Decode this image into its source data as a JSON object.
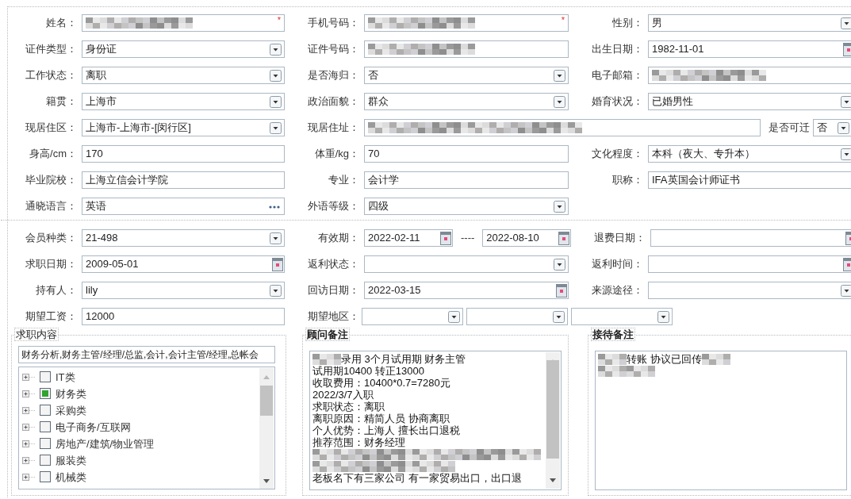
{
  "sections": [
    {
      "rows": [
        [
          {
            "label": "姓名：",
            "kind": "text",
            "redacted": true,
            "required_mark": "*"
          },
          {
            "label": "手机号码：",
            "kind": "text",
            "redacted": true,
            "required_mark": "*"
          },
          {
            "label": "性别：",
            "kind": "select",
            "value": "男"
          }
        ],
        [
          {
            "label": "证件类型：",
            "kind": "select",
            "value": "身份证"
          },
          {
            "label": "证件号码：",
            "kind": "text",
            "redacted": true
          },
          {
            "label": "出生日期：",
            "kind": "date",
            "value": "1982-11-01"
          }
        ],
        [
          {
            "label": "工作状态：",
            "kind": "select",
            "value": "离职"
          },
          {
            "label": "是否海归：",
            "kind": "select",
            "value": "否"
          },
          {
            "label": "电子邮箱：",
            "kind": "text",
            "redacted": true
          }
        ],
        [
          {
            "label": "籍贯：",
            "kind": "select",
            "value": "上海市"
          },
          {
            "label": "政治面貌：",
            "kind": "select",
            "value": "群众"
          },
          {
            "label": "婚育状况：",
            "kind": "select",
            "value": "已婚男性"
          }
        ],
        [
          {
            "label": "现居住区：",
            "kind": "select",
            "value": "上海市-上海市-[闵行区]"
          },
          {
            "label": "现居住址：",
            "kind": "wide-text",
            "redacted": true
          },
          {
            "label": "是否可迁",
            "kind": "short-select",
            "value": "否"
          }
        ],
        [
          {
            "label": "身高/cm：",
            "kind": "text",
            "value": "170"
          },
          {
            "label": "体重/kg：",
            "kind": "text",
            "value": "70"
          },
          {
            "label": "文化程度：",
            "kind": "select",
            "value": "本科（夜大、专升本）"
          }
        ],
        [
          {
            "label": "毕业院校：",
            "kind": "text",
            "value": "上海立信会计学院"
          },
          {
            "label": "专业：",
            "kind": "text",
            "value": "会计学"
          },
          {
            "label": "职称：",
            "kind": "text",
            "value": "IFA英国会计师证书"
          }
        ],
        [
          {
            "label": "通晓语言：",
            "kind": "picker",
            "value": "英语"
          },
          {
            "label": "外语等级：",
            "kind": "select",
            "value": "四级"
          }
        ]
      ]
    },
    {
      "rows": [
        [
          {
            "label": "会员种类：",
            "kind": "select",
            "value": "21-498"
          },
          {
            "label": "有效期：",
            "kind": "date-range",
            "value": "2022-02-11",
            "separator": "----",
            "value_end": "2022-08-10"
          },
          {
            "label": "退费日期：",
            "kind": "date"
          }
        ],
        [
          {
            "label": "求职日期：",
            "kind": "date",
            "value": "2009-05-01"
          },
          {
            "label": "返利状态：",
            "kind": "select"
          },
          {
            "label": "返利时间：",
            "kind": "date"
          }
        ],
        [
          {
            "label": "持有人：",
            "kind": "select",
            "value": "lily"
          },
          {
            "label": "回访日期：",
            "kind": "date",
            "value": "2022-03-15"
          },
          {
            "label": "来源途径：",
            "kind": "select"
          }
        ],
        [
          {
            "label": "期望工资：",
            "kind": "text",
            "value": "12000"
          },
          {
            "label": "期望地区：",
            "kind": "region-select"
          }
        ]
      ]
    }
  ],
  "job_content": {
    "title": "求职内容",
    "emphasized": false,
    "selected_text": "财务分析,财务主管/经理/总监,会计,会计主管/经理,总帐会",
    "tree": [
      {
        "label": "IT类",
        "checked": false,
        "expanded": false
      },
      {
        "label": "财务类",
        "checked": true,
        "expanded": false
      },
      {
        "label": "采购类",
        "checked": false,
        "expanded": false
      },
      {
        "label": "电子商务/互联网",
        "checked": false,
        "expanded": false
      },
      {
        "label": "房地产/建筑/物业管理",
        "checked": false,
        "expanded": false
      },
      {
        "label": "服装类",
        "checked": false,
        "expanded": false
      },
      {
        "label": "机械类",
        "checked": false,
        "expanded": false
      }
    ]
  },
  "notes": [
    {
      "title": "顾问备注",
      "emphasized": true,
      "scrollbar": true,
      "lines": [
        [
          {
            "kind": "blur-short"
          },
          {
            "kind": "text",
            "text": "录用 3个月试用期 财务主管"
          }
        ],
        [
          {
            "kind": "text",
            "text": "试用期10400 转正13000"
          }
        ],
        [
          {
            "kind": "text",
            "text": "收取费用：10400*0.7=7280元"
          }
        ],
        [
          {
            "kind": "text",
            "text": "2022/3/7入职"
          }
        ],
        [
          {
            "kind": "text",
            "text": "求职状态：离职"
          }
        ],
        [
          {
            "kind": "text",
            "text": "离职原因：精简人员  协商离职"
          }
        ],
        [
          {
            "kind": "text",
            "text": "个人优势：上海人 擅长出口退税"
          }
        ],
        [
          {
            "kind": "text",
            "text": "推荐范围：财务经理"
          }
        ],
        [
          {
            "kind": "blur-long"
          }
        ],
        [
          {
            "kind": "blur-half"
          }
        ],
        [
          {
            "kind": "text",
            "text": "老板名下有三家公司 有一家贸易出口，出口退"
          }
        ]
      ]
    },
    {
      "title": "接待备注",
      "emphasized": true,
      "scrollbar": false,
      "lines": [
        [
          {
            "kind": "blur-short"
          },
          {
            "kind": "text",
            "text": "转账 协议已回传 "
          },
          {
            "kind": "blur-short"
          }
        ],
        [
          {
            "kind": "blur-short"
          },
          {
            "kind": "blur-short"
          }
        ]
      ]
    }
  ]
}
